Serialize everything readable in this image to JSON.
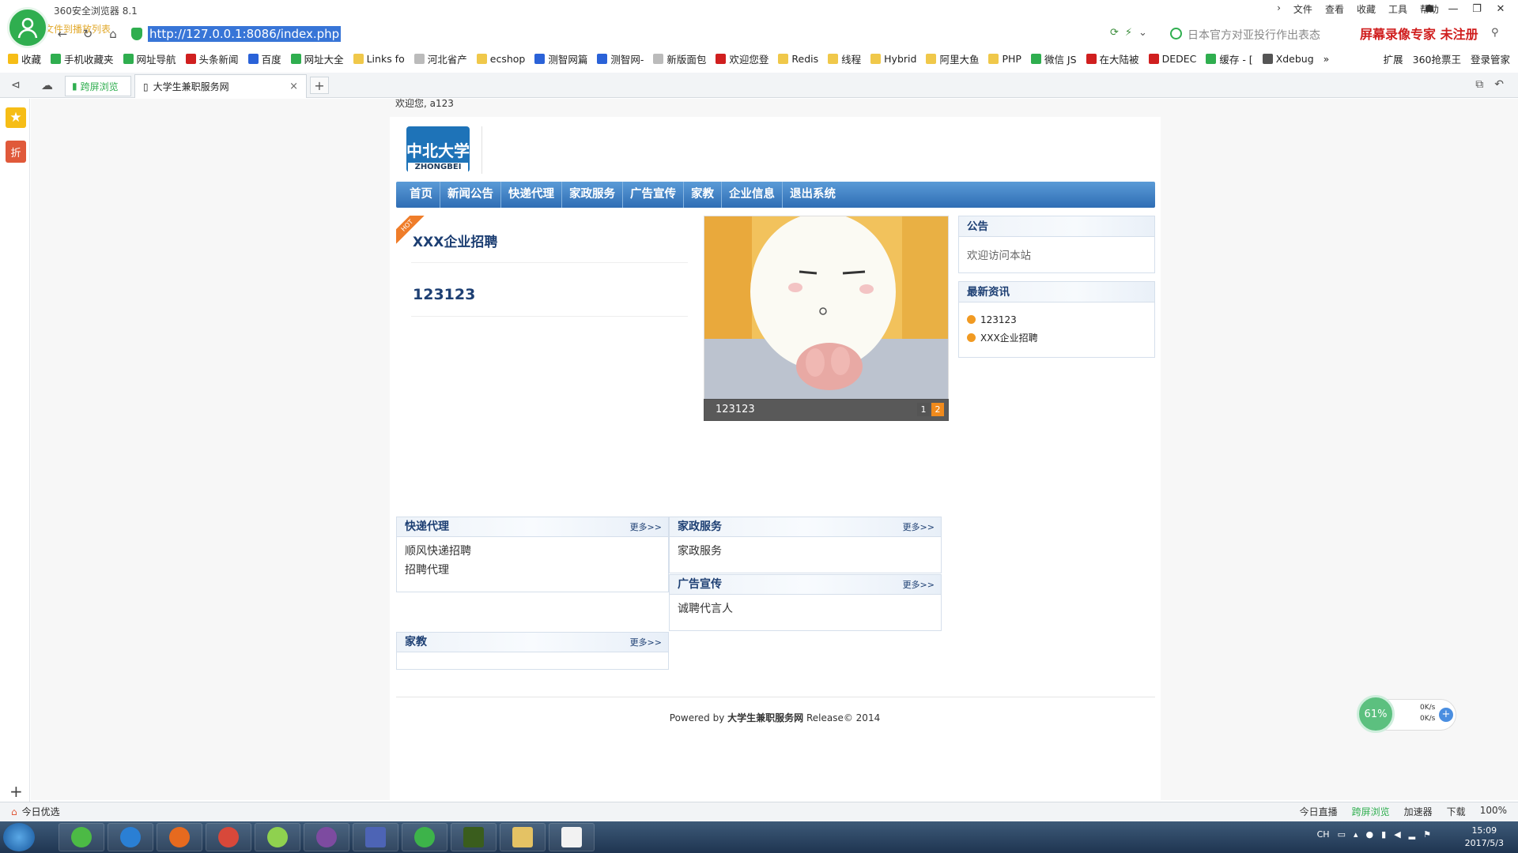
{
  "browser": {
    "app_title": "360安全浏览器 8.1",
    "addr_subtitle": "自定义个文件到播放列表",
    "url": "http://127.0.0.1:8086/index.php",
    "search_placeholder": "日本官方对亚投行作出表态",
    "ad_text": "屏幕录像专家  未注册",
    "menu": [
      "文件",
      "查看",
      "收藏",
      "工具",
      "帮助"
    ],
    "bookmarks": [
      {
        "label": "收藏",
        "color": "#f6bd16"
      },
      {
        "label": "手机收藏夹",
        "color": "#2fae4f"
      },
      {
        "label": "网址导航",
        "color": "#2fae4f"
      },
      {
        "label": "头条新闻",
        "color": "#d01f1f"
      },
      {
        "label": "百度",
        "color": "#2a62d8"
      },
      {
        "label": "网址大全",
        "color": "#2fae4f"
      },
      {
        "label": "Links fo",
        "color": "#f0c84a"
      },
      {
        "label": "河北省产",
        "color": "#bbbbbb"
      },
      {
        "label": "ecshop",
        "color": "#f0c84a"
      },
      {
        "label": "测智网篇",
        "color": "#2a62d8"
      },
      {
        "label": "测智网-",
        "color": "#2a62d8"
      },
      {
        "label": "新版面包",
        "color": "#bbbbbb"
      },
      {
        "label": "欢迎您登",
        "color": "#d01f1f"
      },
      {
        "label": "Redis",
        "color": "#f0c84a"
      },
      {
        "label": "线程",
        "color": "#f0c84a"
      },
      {
        "label": "Hybrid",
        "color": "#f0c84a"
      },
      {
        "label": "阿里大鱼",
        "color": "#f0c84a"
      },
      {
        "label": "PHP",
        "color": "#f0c84a"
      },
      {
        "label": "微信 JS",
        "color": "#2fae4f"
      },
      {
        "label": "在大陆被",
        "color": "#d01f1f"
      },
      {
        "label": "DEDEC",
        "color": "#d01f1f"
      },
      {
        "label": "缓存 - [",
        "color": "#2fae4f"
      },
      {
        "label": "Xdebug",
        "color": "#555555"
      }
    ],
    "bookmarks_right": [
      "扩展",
      "360抢票王",
      "登录管家"
    ],
    "tab_split_label": "跨屏浏览",
    "tab_title": "大学生兼职服务网"
  },
  "site": {
    "welcome": "欢迎您, a123",
    "logo_text": "中北大学",
    "logo_sub": "ZHONGBEI",
    "nav": [
      "首页",
      "新闻公告",
      "快递代理",
      "家政服务",
      "广告宣传",
      "家教",
      "企业信息",
      "退出系统"
    ],
    "hot_tag": "HOT",
    "featured": [
      "XXX企业招聘",
      "123123"
    ],
    "slide": {
      "caption": "123123",
      "pages": [
        "1",
        "2"
      ],
      "active_page": "2"
    },
    "notice": {
      "title": "公告",
      "body": "欢迎访问本站"
    },
    "news": {
      "title": "最新资讯",
      "items": [
        "123123",
        "XXX企业招聘"
      ]
    },
    "categories": {
      "express": {
        "title": "快递代理",
        "more": "更多>>",
        "items": [
          "顺风快递招聘",
          "招聘代理"
        ]
      },
      "housekeeping": {
        "title": "家政服务",
        "more": "更多>>",
        "items": [
          "家政服务"
        ]
      },
      "ads": {
        "title": "广告宣传",
        "more": "更多>>",
        "items": [
          "诚聘代言人"
        ]
      },
      "tutor": {
        "title": "家教",
        "more": "更多>>",
        "items": []
      }
    },
    "footer": {
      "prefix": "Powered by ",
      "site": "大学生兼职服务网",
      "suffix": " Release© 2014"
    }
  },
  "netspeed": {
    "percent": "61%",
    "up": "0K/s",
    "down": "0K/s"
  },
  "statusbar": {
    "left": "今日优选",
    "right": [
      "今日直播",
      "跨屏浏览",
      "加速器",
      "下载",
      "100%"
    ]
  },
  "taskbar": {
    "tray_lang": "CH",
    "time": "15:09",
    "date": "2017/5/3"
  }
}
